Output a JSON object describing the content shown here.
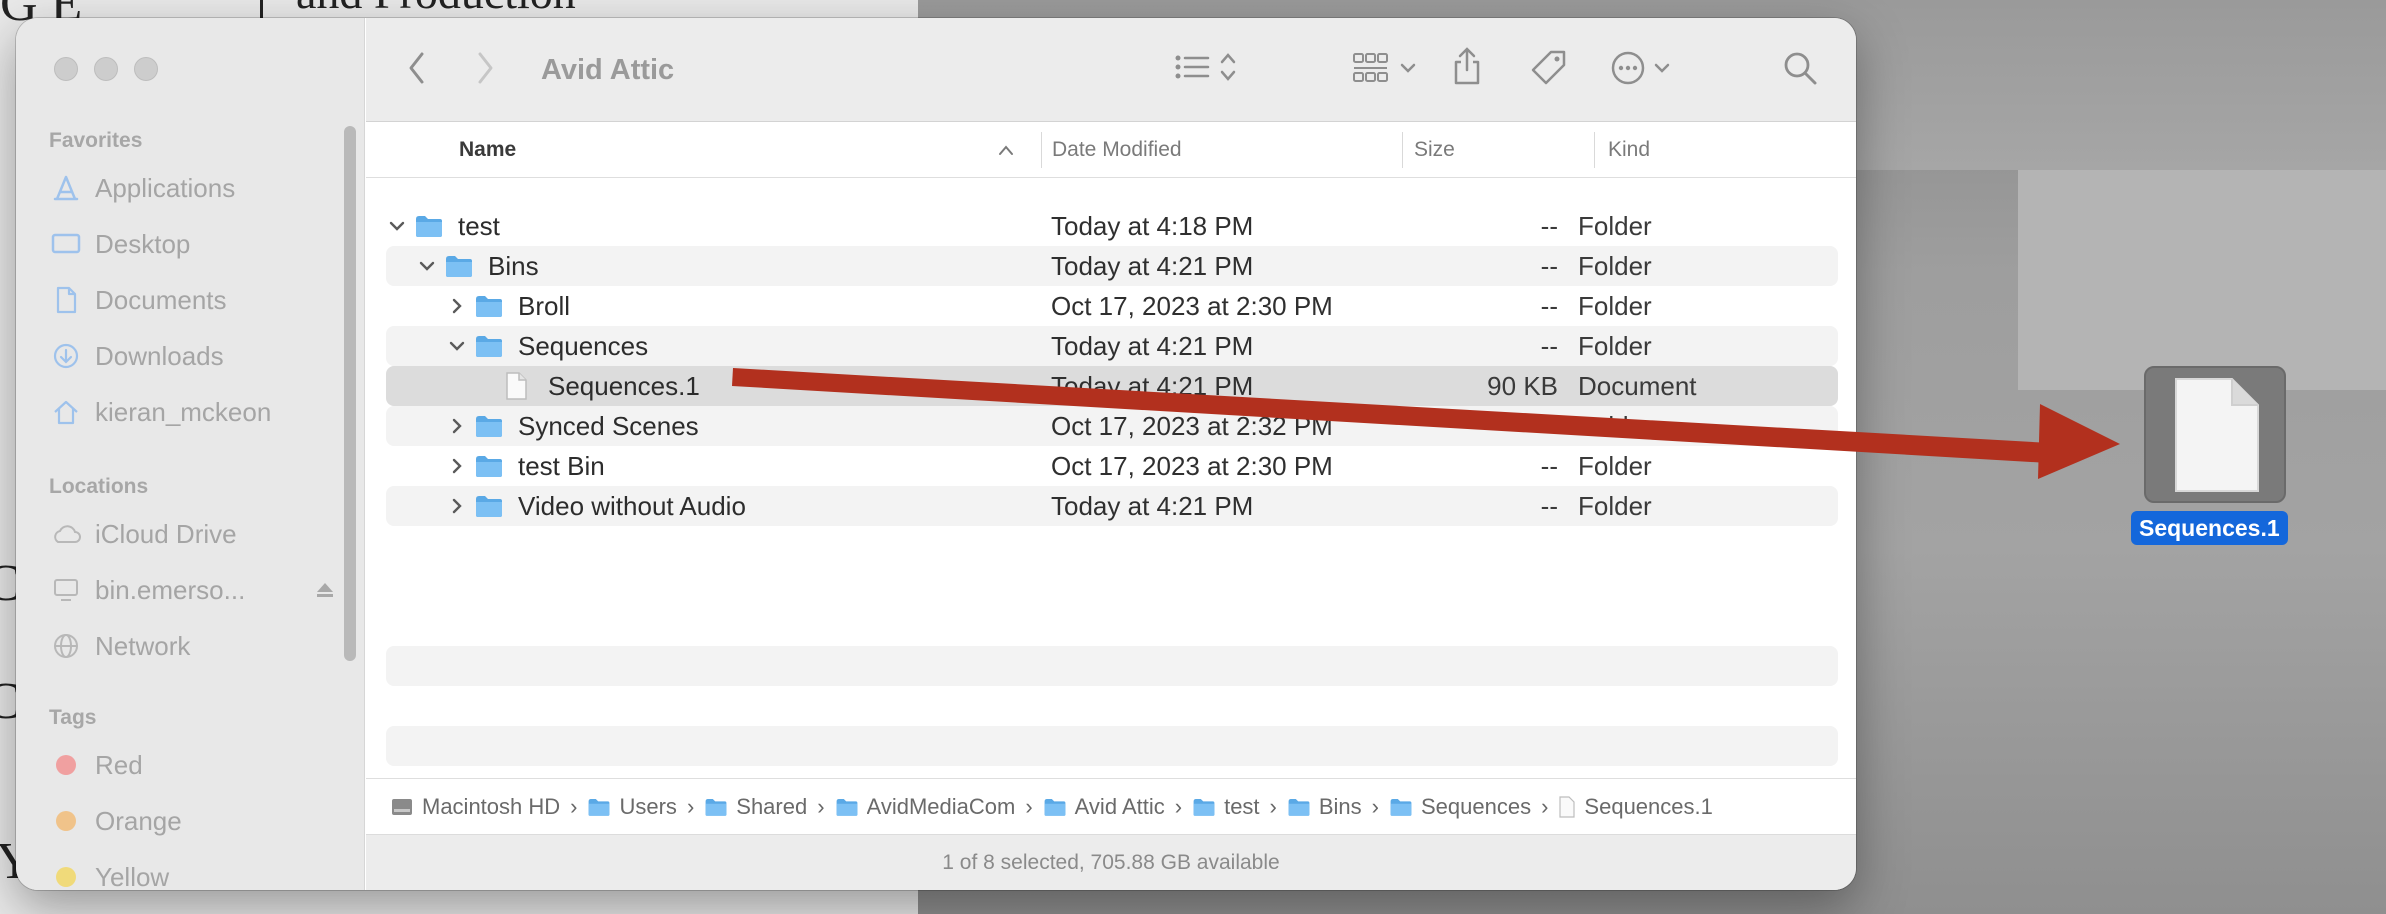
{
  "window": {
    "title": "Avid Attic"
  },
  "sidebar": {
    "favorites_title": "Favorites",
    "favorites": [
      {
        "label": "Applications",
        "icon": "applications-icon"
      },
      {
        "label": "Desktop",
        "icon": "desktop-icon"
      },
      {
        "label": "Documents",
        "icon": "document-icon"
      },
      {
        "label": "Downloads",
        "icon": "downloads-icon"
      },
      {
        "label": "kieran_mckeon",
        "icon": "home-icon"
      }
    ],
    "locations_title": "Locations",
    "locations": [
      {
        "label": "iCloud Drive",
        "icon": "cloud-icon"
      },
      {
        "label": "bin.emerso...",
        "icon": "server-icon"
      },
      {
        "label": "Network",
        "icon": "network-icon"
      }
    ],
    "tags_title": "Tags",
    "tags": [
      {
        "label": "Red",
        "color": "#f0a0a0"
      },
      {
        "label": "Orange",
        "color": "#f0c38a"
      },
      {
        "label": "Yellow",
        "color": "#f0da7a"
      }
    ]
  },
  "columns": {
    "name": "Name",
    "date": "Date Modified",
    "size": "Size",
    "kind": "Kind"
  },
  "rows": [
    {
      "name": "test",
      "date": "Today at 4:18 PM",
      "size": "--",
      "kind": "Folder",
      "level": 0,
      "type": "folder",
      "disclosure": "open"
    },
    {
      "name": "Bins",
      "date": "Today at 4:21 PM",
      "size": "--",
      "kind": "Folder",
      "level": 1,
      "type": "folder",
      "disclosure": "open"
    },
    {
      "name": "Broll",
      "date": "Oct 17, 2023 at 2:30 PM",
      "size": "--",
      "kind": "Folder",
      "level": 2,
      "type": "folder",
      "disclosure": "closed"
    },
    {
      "name": "Sequences",
      "date": "Today at 4:21 PM",
      "size": "--",
      "kind": "Folder",
      "level": 2,
      "type": "folder",
      "disclosure": "open"
    },
    {
      "name": "Sequences.1",
      "date": "Today at 4:21 PM",
      "size": "90 KB",
      "kind": "Document",
      "level": 3,
      "type": "document",
      "disclosure": "none",
      "selected": true
    },
    {
      "name": "Synced Scenes",
      "date": "Oct 17, 2023 at 2:32 PM",
      "size": "--",
      "kind": "Folder",
      "level": 2,
      "type": "folder",
      "disclosure": "closed"
    },
    {
      "name": "test Bin",
      "date": "Oct 17, 2023 at 2:30 PM",
      "size": "--",
      "kind": "Folder",
      "level": 2,
      "type": "folder",
      "disclosure": "closed"
    },
    {
      "name": "Video without Audio",
      "date": "Today at 4:21 PM",
      "size": "--",
      "kind": "Folder",
      "level": 2,
      "type": "folder",
      "disclosure": "closed"
    }
  ],
  "pathbar": [
    {
      "label": "Macintosh HD",
      "icon": "disk-icon"
    },
    {
      "label": "Users",
      "icon": "folder-icon"
    },
    {
      "label": "Shared",
      "icon": "folder-icon"
    },
    {
      "label": "AvidMediaCom",
      "icon": "folder-icon"
    },
    {
      "label": "Avid Attic",
      "icon": "folder-icon"
    },
    {
      "label": "test",
      "icon": "folder-icon"
    },
    {
      "label": "Bins",
      "icon": "folder-icon"
    },
    {
      "label": "Sequences",
      "icon": "folder-icon"
    },
    {
      "label": "Sequences.1",
      "icon": "document-icon"
    }
  ],
  "status": "1 of 8 selected, 705.88 GB available",
  "drag": {
    "label": "Sequences.1",
    "arrow_color": "#b2301e"
  },
  "background": {
    "top_text": "G E",
    "top_text_right": "and Production",
    "left_chars": [
      "C",
      "C",
      "Y"
    ]
  }
}
